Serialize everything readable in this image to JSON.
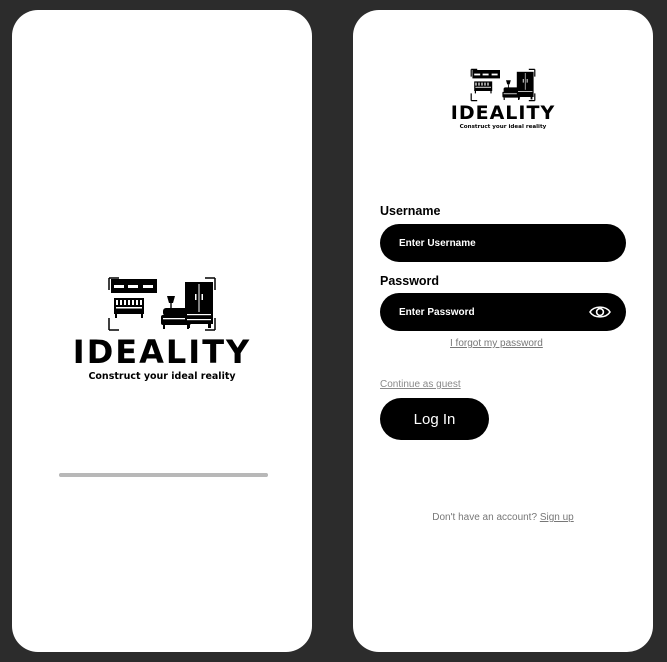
{
  "brand": {
    "name": "IDEALITY",
    "tagline": "Construct your ideal reality"
  },
  "splash": {
    "progress": 1.0
  },
  "login": {
    "username": {
      "label": "Username",
      "placeholder": "Enter Username",
      "value": ""
    },
    "password": {
      "label": "Password",
      "placeholder": "Enter Password",
      "value": "",
      "toggle_icon": "eye-icon"
    },
    "forgot_link": "I forgot my password",
    "guest_link": "Continue as guest",
    "login_button": "Log In",
    "signup_prompt": "Don't have an account?",
    "signup_link": "Sign up"
  },
  "colors": {
    "background": "#2c2c2c",
    "screen": "#ffffff",
    "primary": "#000000",
    "muted_text": "#777777",
    "progress_track": "#b8b8b8"
  }
}
